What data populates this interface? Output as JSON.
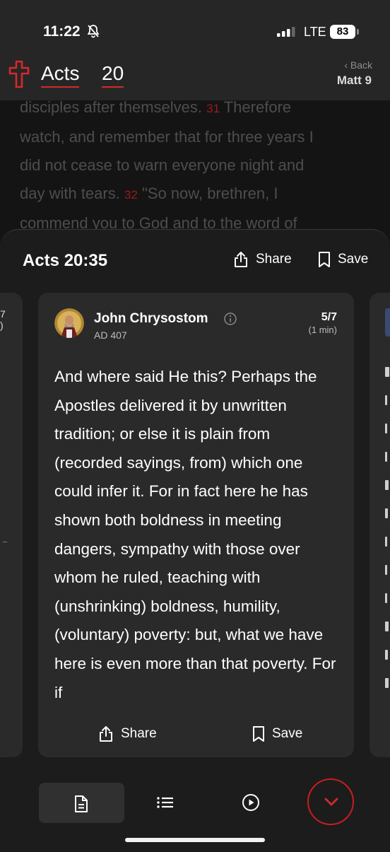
{
  "status_bar": {
    "time": "11:22",
    "network": "LTE",
    "battery": "83"
  },
  "nav": {
    "book": "Acts",
    "chapter": "20",
    "back_label": "‹  Back",
    "back_target": "Matt 9"
  },
  "background_text": {
    "lines": [
      [
        "disciples after themselves. ",
        "31",
        " Therefore"
      ],
      [
        "watch, and remember that for three years I"
      ],
      [
        "did not cease to warn everyone night and"
      ],
      [
        "day with tears. ",
        "32",
        " \"So now, brethren, I"
      ],
      [
        "commend you to God and to the word of"
      ]
    ]
  },
  "sheet": {
    "title": "Acts 20:35",
    "share_label": "Share",
    "save_label": "Save"
  },
  "card": {
    "author": "John Chrysostom",
    "date": "AD 407",
    "counter": "5/7",
    "duration": "(1 min)",
    "quote": "And where said He this? Perhaps the Apostles delivered it by unwritten tradition; or else it is plain from (recorded sayings, from) which one could infer it. For in fact here he has shown both boldness in meeting dangers, sympathy with those over whom he ruled, teaching with (unshrinking) boldness, humility, (voluntary) poverty: but, what we have here is even more than that poverty. For if",
    "share_label": "Share",
    "save_label": "Save"
  },
  "peek_left": {
    "counter": "7",
    "sub": ")"
  },
  "tabs": [
    {
      "icon": "document-icon",
      "selected": true
    },
    {
      "icon": "list-icon",
      "selected": false
    },
    {
      "icon": "play-icon",
      "selected": false
    }
  ],
  "colors": {
    "accent": "#d42a2a",
    "background": "#141414",
    "card": "#2a2a2a"
  }
}
